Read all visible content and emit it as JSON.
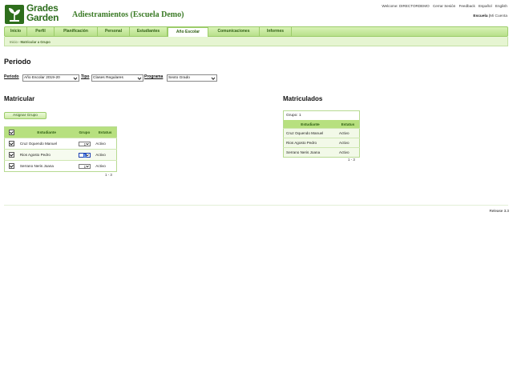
{
  "brand": {
    "logo_line1": "Grades",
    "logo_line2": "Garden",
    "app_title": "Adiestramientos (Escuela Demo)"
  },
  "toplinks": {
    "welcome": "Welcome: DIRECTORDEMO",
    "logout": "Cerrar Sesión",
    "feedback": "Feedback",
    "spanish": "Español",
    "english": "English"
  },
  "role": {
    "current": "Escuela",
    "sep": "|",
    "other": "Mi Cuenta"
  },
  "nav": {
    "tabs": [
      "Inicio",
      "Perfil",
      "Planificación",
      "Personal",
      "Estudiantes",
      "Año Escolar",
      "Comunicaciones",
      "Informes"
    ],
    "active_index": 5
  },
  "breadcrumb": {
    "home": "Inicio",
    "sep": "›",
    "current": "Matricular a Grupo"
  },
  "periodo": {
    "heading": "Periodo",
    "periodo_label": "Periodo",
    "periodo_value": "Año Escolar 2019-20",
    "tipo_label": "Tipo",
    "tipo_value": "Clases Regulares",
    "programa_label": "Programa",
    "programa_value": "Sexto Grado"
  },
  "matricular": {
    "heading": "Matricular",
    "assign_button": "Asignar Grupo",
    "headers": {
      "estudiante": "Estudiante",
      "grupo": "Grupo",
      "estatus": "Estatus"
    },
    "rows": [
      {
        "name": "Cruz Oquendo Manuel",
        "grupo": "1",
        "estatus": "Activo"
      },
      {
        "name": "Rios Agosto Pedro",
        "grupo": "1",
        "estatus": "Activo"
      },
      {
        "name": "Serrano Neris Joana",
        "grupo": "1",
        "estatus": "Activo"
      }
    ],
    "pagination": "1 - 3"
  },
  "matriculados": {
    "heading": "Matriculados",
    "group_label": "Grupo: 1",
    "headers": {
      "estudiante": "Estudiante",
      "estatus": "Estatus"
    },
    "rows": [
      {
        "name": "Cruz Oquendo Manuel",
        "estatus": "Activo"
      },
      {
        "name": "Rios Agosto Pedro",
        "estatus": "Activo"
      },
      {
        "name": "Serrano Neris Joana",
        "estatus": "Activo"
      }
    ],
    "pagination": "1 - 3"
  },
  "footer": {
    "release": "Release 3.3"
  },
  "colors": {
    "brand_green": "#2e6e1c",
    "nav_green": "#b8e08a",
    "header_cell": "#b7e07f"
  }
}
